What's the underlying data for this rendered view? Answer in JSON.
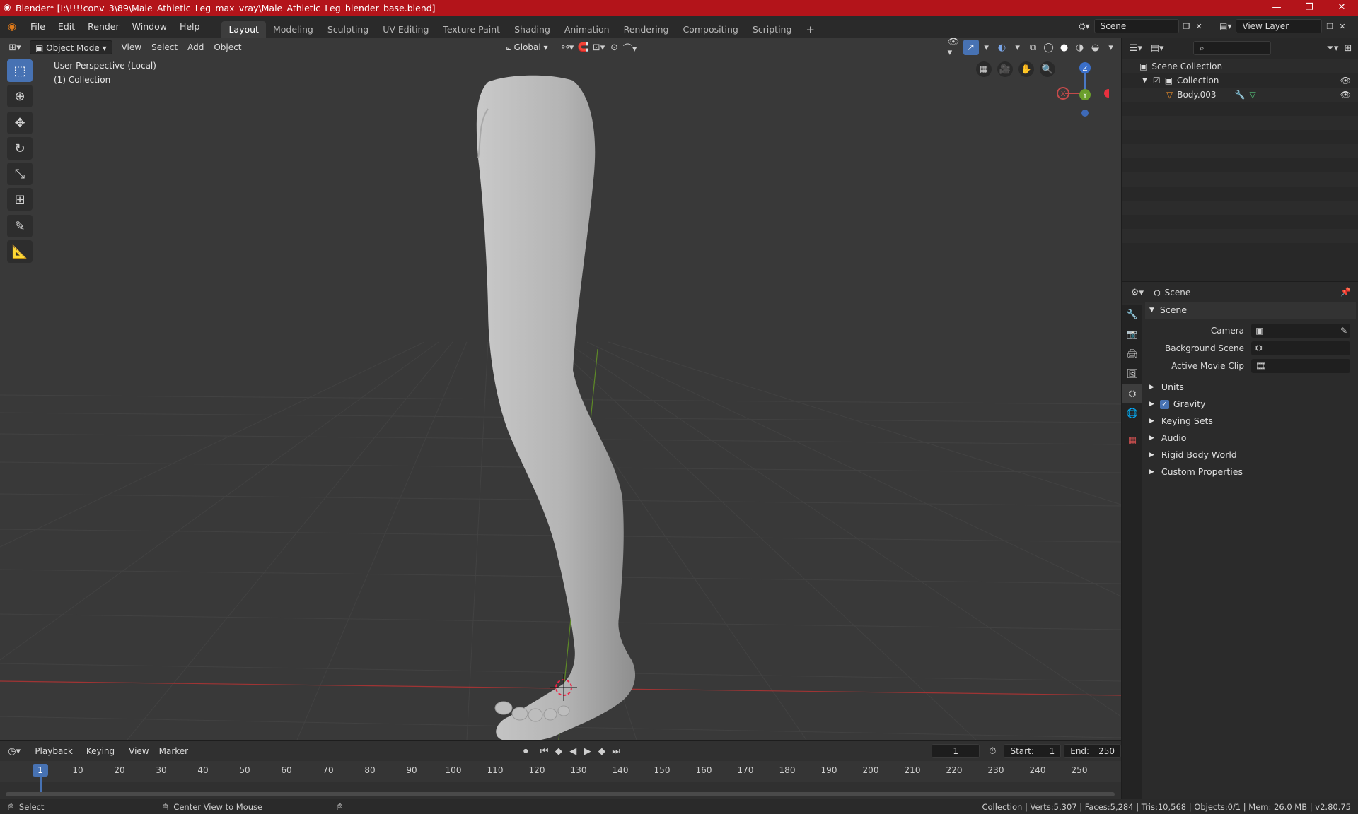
{
  "window": {
    "title": "Blender* [I:\\!!!!conv_3\\89\\Male_Athletic_Leg_max_vray\\Male_Athletic_Leg_blender_base.blend]",
    "minimize": "—",
    "maximize": "❐",
    "close": "✕"
  },
  "menu": {
    "items": [
      "File",
      "Edit",
      "Render",
      "Window",
      "Help"
    ],
    "workspaces": [
      "Layout",
      "Modeling",
      "Sculpting",
      "UV Editing",
      "Texture Paint",
      "Shading",
      "Animation",
      "Rendering",
      "Compositing",
      "Scripting"
    ],
    "active_workspace": "Layout",
    "add_tab": "+",
    "scene": "Scene",
    "view_layer": "View Layer"
  },
  "viewport": {
    "mode": "Object Mode",
    "menus": [
      "View",
      "Select",
      "Add",
      "Object"
    ],
    "transform_orientation": "Global",
    "overlay_line1": "User Perspective (Local)",
    "overlay_line2": "(1) Collection",
    "gizmo": {
      "z": "Z",
      "y": "Y",
      "x": "X"
    }
  },
  "outliner": {
    "search_placeholder": "",
    "root": "Scene Collection",
    "collection": "Collection",
    "object": "Body.003"
  },
  "properties": {
    "header": "Scene",
    "panel": "Scene",
    "camera_label": "Camera",
    "background_scene_label": "Background Scene",
    "active_movie_clip_label": "Active Movie Clip",
    "sections": [
      "Units",
      "Gravity",
      "Keying Sets",
      "Audio",
      "Rigid Body World",
      "Custom Properties"
    ],
    "gravity_checked": true
  },
  "timeline": {
    "menus": [
      "Playback",
      "Keying",
      "View",
      "Marker"
    ],
    "current_frame": "1",
    "start_label": "Start:",
    "start": "1",
    "end_label": "End:",
    "end": "250",
    "ticks": [
      "1",
      "10",
      "20",
      "30",
      "40",
      "50",
      "60",
      "70",
      "80",
      "90",
      "100",
      "110",
      "120",
      "130",
      "140",
      "150",
      "160",
      "170",
      "180",
      "190",
      "200",
      "210",
      "220",
      "230",
      "240",
      "250"
    ]
  },
  "status": {
    "select": "Select",
    "center_view": "Center View to Mouse",
    "stats": "Collection | Verts:5,307 | Faces:5,284 | Tris:10,568 | Objects:0/1 | Mem: 26.0 MB | v2.80.75"
  },
  "colors": {
    "title_bar": "#b3141a",
    "accent": "#4772b3",
    "viewport_bg": "#393939",
    "axis_red": "#c43b3b",
    "axis_green": "#6a9e2b"
  }
}
